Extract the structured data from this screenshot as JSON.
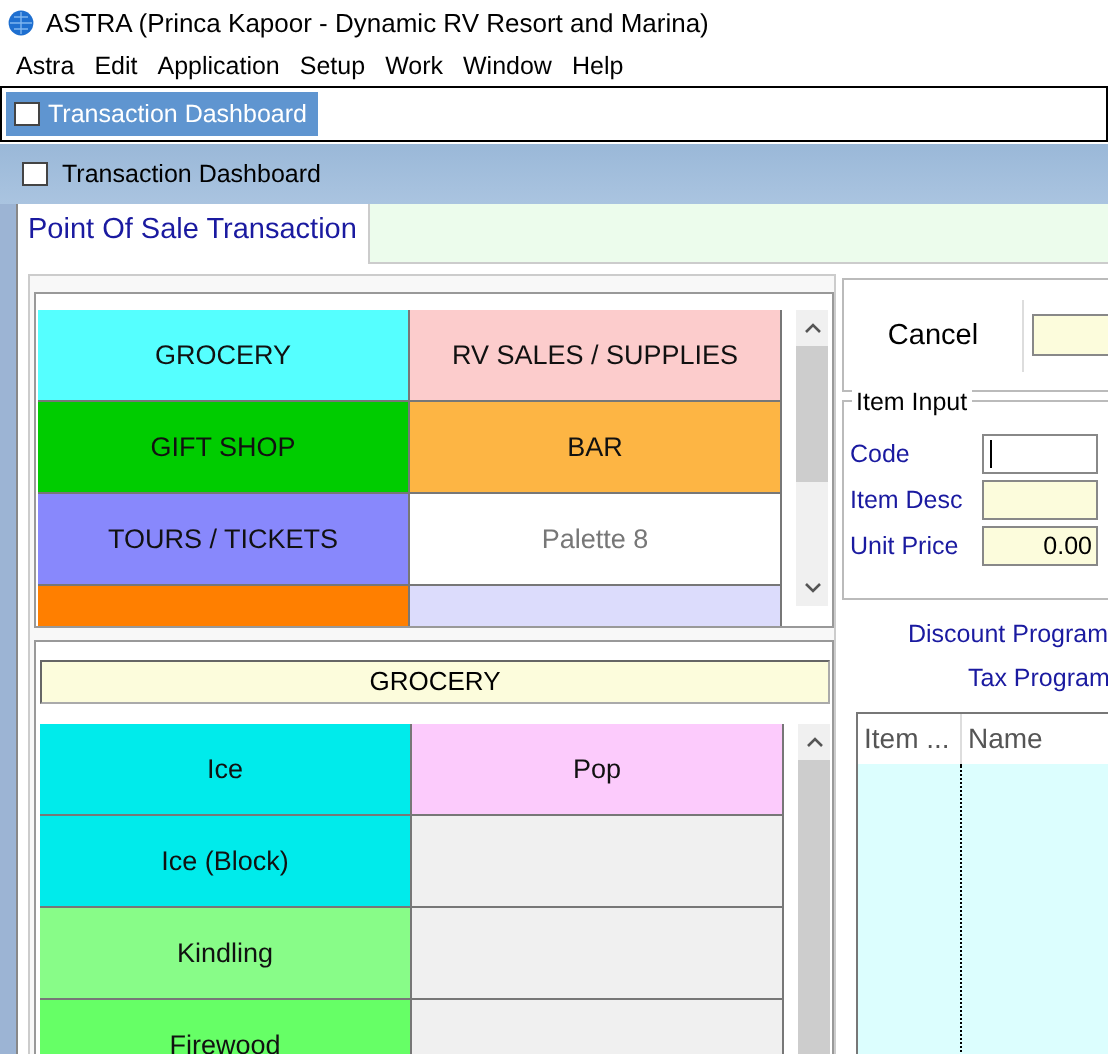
{
  "app": {
    "title": "ASTRA (Princa Kapoor - Dynamic RV Resort and Marina)"
  },
  "menu": [
    "Astra",
    "Edit",
    "Application",
    "Setup",
    "Work",
    "Window",
    "Help"
  ],
  "taskbar": {
    "tabs": [
      {
        "label": "Transaction Dashboard",
        "selected": true
      }
    ]
  },
  "window": {
    "title": "Transaction Dashboard"
  },
  "tabs": [
    {
      "label": "Point Of Sale Transaction",
      "selected": true
    }
  ],
  "categories": [
    {
      "label": "GROCERY",
      "color": "#55ffff",
      "unassigned": false
    },
    {
      "label": "RV SALES / SUPPLIES",
      "color": "#fccccc",
      "unassigned": false
    },
    {
      "label": "GIFT SHOP",
      "color": "#00cc00",
      "unassigned": false
    },
    {
      "label": "BAR",
      "color": "#fdb544",
      "unassigned": false
    },
    {
      "label": "TOURS / TICKETS",
      "color": "#8888fc",
      "unassigned": false
    },
    {
      "label": "Palette 8",
      "color": "#ffffff",
      "unassigned": true
    },
    {
      "color": "#ff7f00"
    },
    {
      "color": "#dcdcfc"
    }
  ],
  "category_header": "GROCERY",
  "items": [
    {
      "label": "Ice",
      "color": "#00ebeb"
    },
    {
      "label": "Pop",
      "color": "#fccbfc"
    },
    {
      "label": "Ice (Block)",
      "color": "#00ebeb"
    },
    {
      "color": "#f0f0f0"
    },
    {
      "label": "Kindling",
      "color": "#88fc88"
    },
    {
      "color": "#f0f0f0"
    },
    {
      "label": "Firewood",
      "color": "#66ff66"
    },
    {
      "color": "#f0f0f0"
    }
  ],
  "cancel_button": "Cancel",
  "item_input": {
    "title": "Item Input",
    "fields": [
      {
        "label": "Code",
        "focused": true
      },
      {
        "label": "Item Desc",
        "focused": false
      },
      {
        "label": "Unit Price",
        "value": "0.00",
        "focused": false
      }
    ]
  },
  "links": [
    "Discount Program",
    "Tax Program"
  ],
  "cart": {
    "columns": [
      "Item ...",
      "Name"
    ]
  }
}
